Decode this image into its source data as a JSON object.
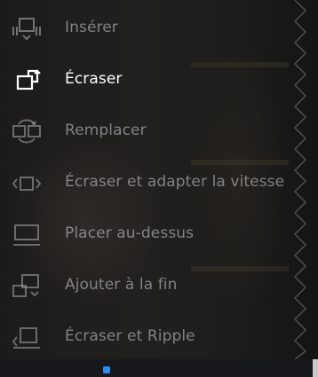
{
  "menu": {
    "items": [
      {
        "label": "Insérer",
        "icon": "insert-icon",
        "active": false
      },
      {
        "label": "Écraser",
        "icon": "overwrite-icon",
        "active": true
      },
      {
        "label": "Remplacer",
        "icon": "replace-icon",
        "active": false
      },
      {
        "label": "Écraser et adapter la vitesse",
        "icon": "fit-to-fill-icon",
        "active": false
      },
      {
        "label": "Placer au-dessus",
        "icon": "place-on-top-icon",
        "active": false
      },
      {
        "label": "Ajouter à la fin",
        "icon": "append-at-end-icon",
        "active": false
      },
      {
        "label": "Écraser et Ripple",
        "icon": "ripple-overwrite-icon",
        "active": false
      }
    ]
  },
  "colors": {
    "active_text": "#ffffff",
    "inactive_text": "#d2d4d8",
    "accent": "#2d8cf0"
  }
}
